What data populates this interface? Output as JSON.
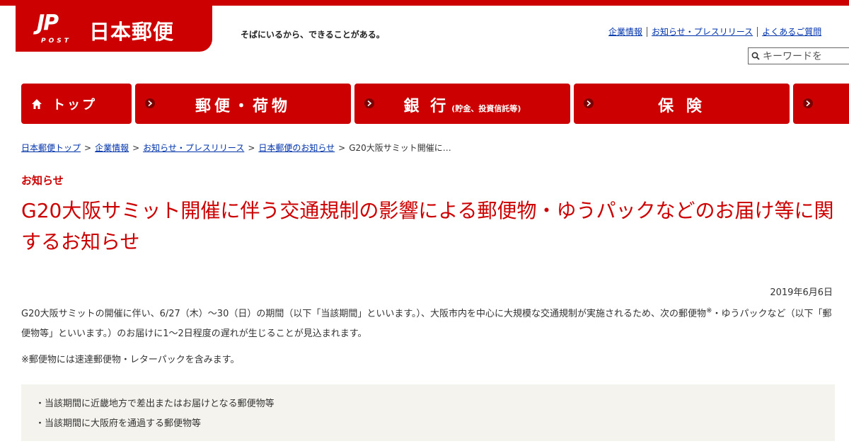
{
  "brand": {
    "logo_mark": "JP",
    "logo_sub": "POST",
    "name": "日本郵便",
    "tagline": "そばにいるから、できることがある。"
  },
  "util_links": [
    "企業情報",
    "お知らせ・プレスリリース",
    "よくあるご質問"
  ],
  "search": {
    "placeholder": "キーワードを"
  },
  "nav": {
    "home": "トップ",
    "mail": "郵便・荷物",
    "bank": "銀 行",
    "bank_sub": "(貯金、投資信託等)",
    "insurance": "保 険"
  },
  "breadcrumb": [
    "日本郵便トップ",
    "企業情報",
    "お知らせ・プレスリリース",
    "日本郵便のお知らせ",
    "G20大阪サミット開催に…"
  ],
  "article": {
    "category": "お知らせ",
    "title": "G20大阪サミット開催に伴う交通規制の影響による郵便物・ゆうパックなどのお届け等に関するお知らせ",
    "date": "2019年6月6日",
    "para_part1": "G20大阪サミットの開催に伴い、6/27（木）～30（日）の期間（以下「当該期間」といいます。）、大阪市内を中心に大規模な交通規制が実施されるため、次の郵便物",
    "para_mark": "※",
    "para_part2": "・ゆうパックなど（以下「郵便物等」といいます。）のお届けに1～2日程度の遅れが生じることが見込まれます。",
    "note": "※郵便物には速達郵便物・レターパックを含みます。",
    "list": [
      "・当該期間に近畿地方で差出またはお届けとなる郵便物等",
      "・当該期間に大阪府を通過する郵便物等"
    ]
  },
  "colors": {
    "brand_red": "#cc0000",
    "link_blue": "#0033aa",
    "list_bg": "#f4f3ee"
  }
}
